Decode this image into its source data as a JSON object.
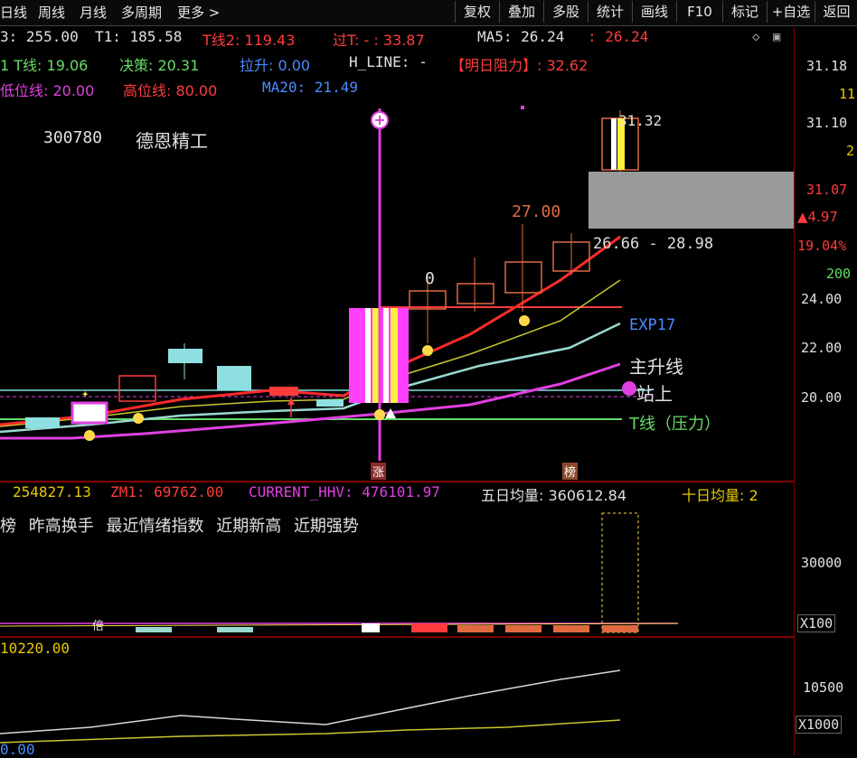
{
  "toolbar": {
    "left_tabs": [
      "日线",
      "周线",
      "月线",
      "多周期",
      "更多 >"
    ],
    "right_buttons": [
      "复权",
      "叠加",
      "多股",
      "统计",
      "画线",
      "F10",
      "标记",
      "+自选",
      "返回"
    ]
  },
  "indicators": {
    "row1": [
      {
        "text": "3: 255.00",
        "color": "#e0e0e0"
      },
      {
        "text": "T1: 185.58",
        "color": "#e0e0e0"
      },
      {
        "text": "T线2: 119.43",
        "color": "#ff3b3b"
      },
      {
        "text": "过T: - : 33.87",
        "color": "#ff3b3b"
      },
      {
        "text": "MA5: 26.24",
        "color": "#e0e0e0"
      },
      {
        "text": ": 26.24",
        "color": "#ff3b3b"
      }
    ],
    "row2": [
      {
        "text": "1 T线: 19.06",
        "color": "#66dd66"
      },
      {
        "text": "决策: 20.31",
        "color": "#66dd66"
      },
      {
        "text": "拉升: 0.00",
        "color": "#4a8cff"
      },
      {
        "text": "H_LINE: -",
        "color": "#e0e0e0"
      },
      {
        "text": "【明日阻力】: 32.62",
        "color": "#ff3b3b"
      }
    ],
    "row3": [
      {
        "text": "低位线: 20.00",
        "color": "#e040e0"
      },
      {
        "text": "高位线: 80.00",
        "color": "#ff3b3b"
      },
      {
        "text": "MA20: 21.49",
        "color": "#4a8cff"
      }
    ]
  },
  "stock": {
    "code": "300780",
    "name": "德恩精工"
  },
  "price_axis": {
    "labels": [
      "31.18",
      "11",
      "31.10",
      "2",
      "31.07",
      "▲4.97",
      "19.04%",
      "200",
      "24.00",
      "22.00",
      "20.00"
    ],
    "colors": [
      "#e0e0e0",
      "#e8c800",
      "#e0e0e0",
      "#e8c800",
      "#ff3b3b",
      "#ff3b3b",
      "#ff3b3b",
      "#66dd66",
      "#e0e0e0",
      "#e0e0e0",
      "#e0e0e0"
    ]
  },
  "annotations": {
    "high_price": "31.32",
    "peak_label": "27.00",
    "zero_label": "0",
    "range_label": "26.66 - 28.98",
    "exp17": "EXP17",
    "main_rise": "主升线",
    "station_up": "站上",
    "t_line": "T线（压力）",
    "zhang_badge": "涨",
    "bang_badge": "榜"
  },
  "volume_panel": {
    "header": [
      {
        "text": "254827.13",
        "color": "#e8c800"
      },
      {
        "text": "ZM1: 69762.00",
        "color": "#ff3b3b"
      },
      {
        "text": "CURRENT_HHV: 476101.97",
        "color": "#e040e0"
      },
      {
        "text": "五日均量: 360612.84",
        "color": "#e0e0e0"
      },
      {
        "text": "十日均量: 2",
        "color": "#e8c800"
      }
    ],
    "tags": [
      "榜",
      "昨高换手",
      "最近情绪指数",
      "近期新高",
      "近期强势"
    ],
    "axis_label": "30000",
    "scale": "X100",
    "small_tag": "倍"
  },
  "bottom_panel": {
    "header": "10220.00",
    "axis_label": "10500",
    "scale": "X1000",
    "footer": "0.00"
  }
}
